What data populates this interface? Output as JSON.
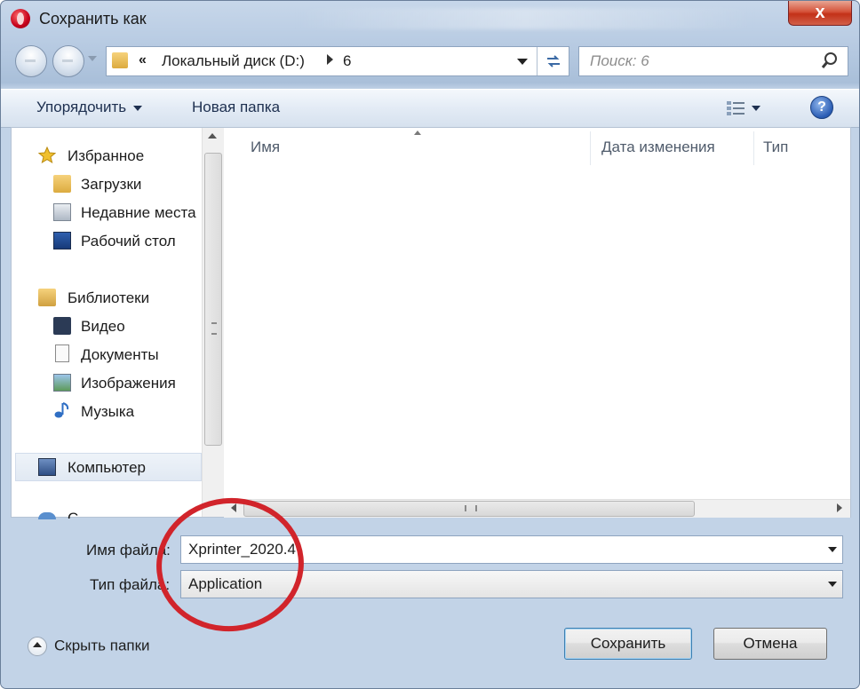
{
  "window": {
    "title": "Сохранить как",
    "close_label": "x"
  },
  "address": {
    "chevrons": "«",
    "crumbs": [
      "Локальный диск (D:)",
      "6"
    ]
  },
  "search": {
    "placeholder": "Поиск: 6"
  },
  "toolbar": {
    "organize_label": "Упорядочить",
    "new_folder_label": "Новая папка",
    "help_label": "?"
  },
  "nav": {
    "favorites": {
      "label": "Избранное",
      "items": [
        "Загрузки",
        "Недавние места",
        "Рабочий стол"
      ]
    },
    "libraries": {
      "label": "Библиотеки",
      "items": [
        "Видео",
        "Документы",
        "Изображения",
        "Музыка"
      ]
    },
    "computer_label": "Компьютер",
    "network_partial": "С"
  },
  "files": {
    "columns": [
      "Имя",
      "Дата изменения",
      "Тип"
    ]
  },
  "form": {
    "filename_label": "Имя файла:",
    "filename_value": "Xprinter_2020.4",
    "filetype_label": "Тип файла:",
    "filetype_value": "Application"
  },
  "footer": {
    "hide_folders_label": "Скрыть папки",
    "save_label": "Сохранить",
    "cancel_label": "Отмена"
  },
  "colors": {
    "annotation_circle": "#d1242b",
    "title_bar": "#b9cce3"
  }
}
